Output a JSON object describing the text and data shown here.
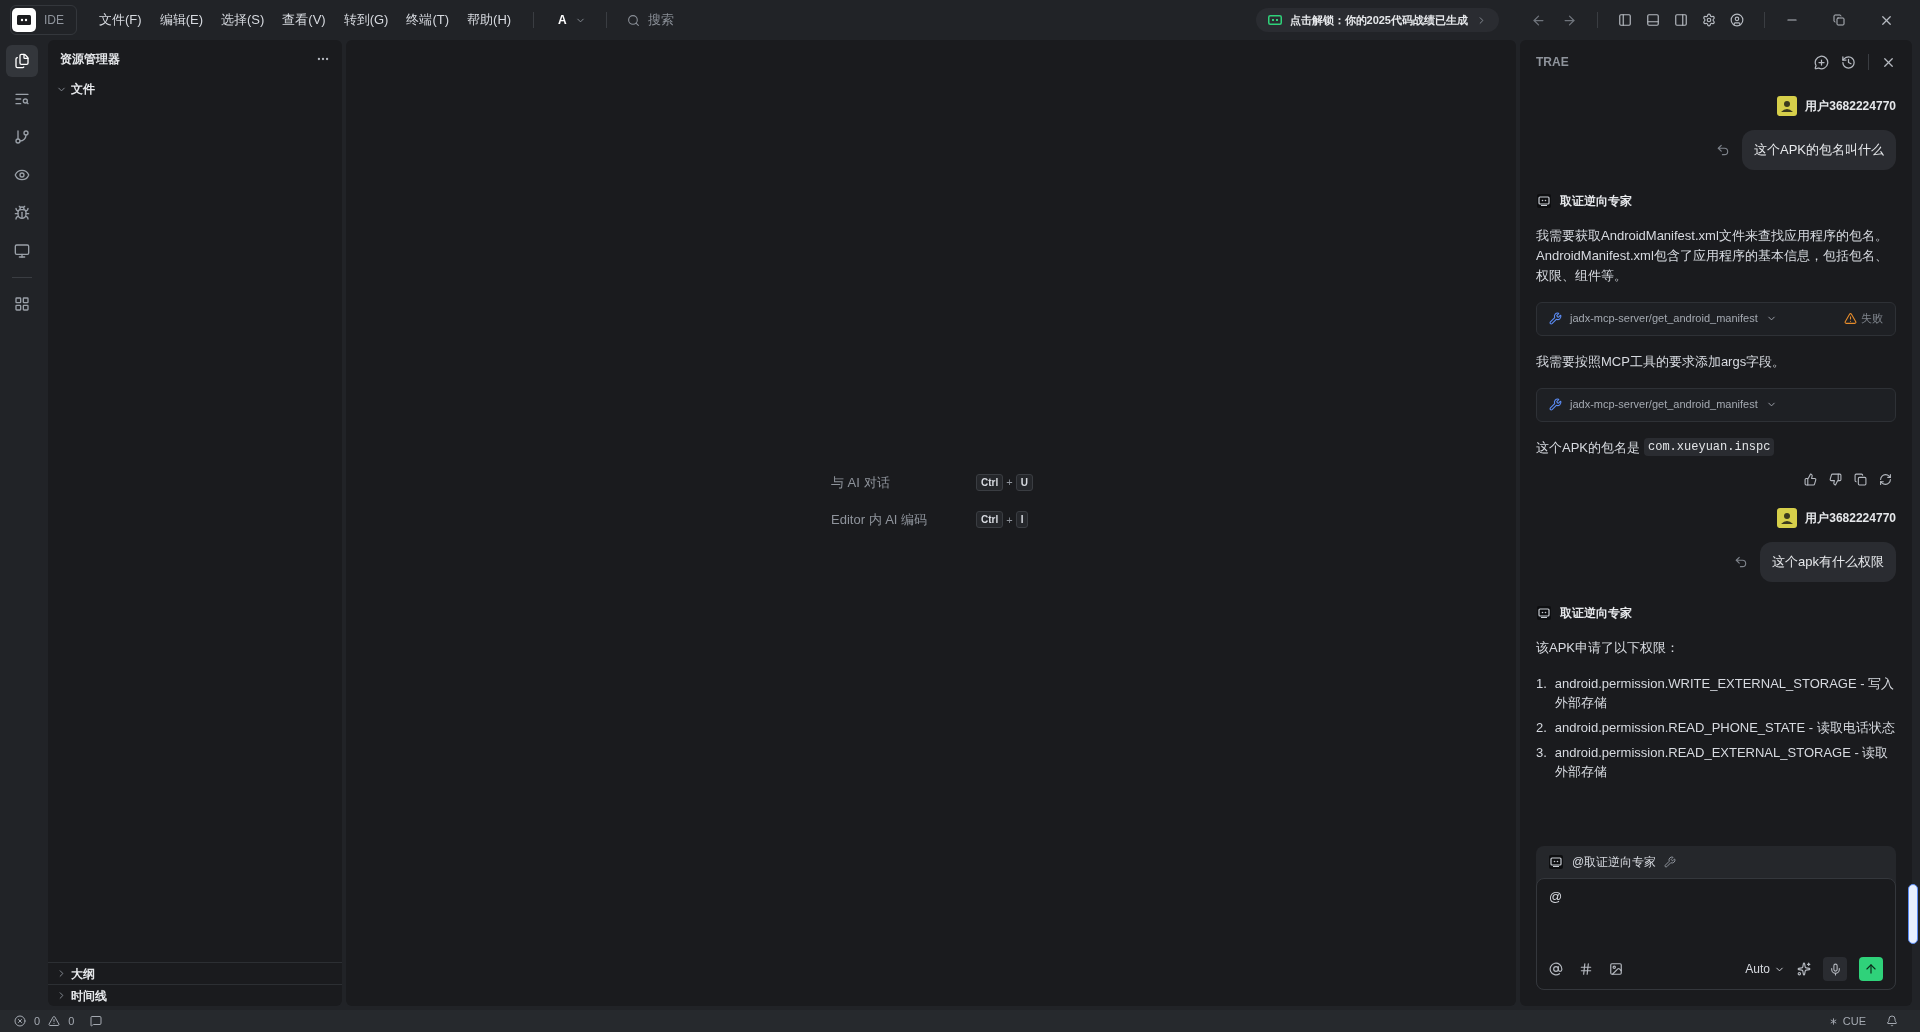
{
  "title_bar": {
    "app_label": "IDE",
    "menus": [
      "文件(F)",
      "编辑(E)",
      "选择(S)",
      "查看(V)",
      "转到(G)",
      "终端(T)",
      "帮助(H)"
    ],
    "font_button": "A",
    "search_placeholder": "搜索",
    "promo": "点击解锁：你的2025代码战绩已生成"
  },
  "activity_bar": [
    {
      "kind": "files",
      "selected": true
    },
    {
      "kind": "search",
      "selected": false
    },
    {
      "kind": "source_control",
      "selected": false
    },
    {
      "kind": "preview",
      "selected": false
    },
    {
      "kind": "debug",
      "selected": false
    },
    {
      "kind": "remote",
      "selected": false
    },
    {
      "kind": "extensions",
      "selected": false
    }
  ],
  "explorer": {
    "title": "资源管理器",
    "sections": [
      {
        "label": "文件",
        "expanded": true
      },
      {
        "label": "大纲",
        "expanded": false
      },
      {
        "label": "时间线",
        "expanded": false
      }
    ]
  },
  "editor": {
    "shortcuts": [
      {
        "label": "与 AI 对话",
        "keys": [
          "Ctrl",
          "+",
          "U"
        ]
      },
      {
        "label": "Editor 内 AI 编码",
        "keys": [
          "Ctrl",
          "+",
          "I"
        ]
      }
    ]
  },
  "chat": {
    "title": "TRAE",
    "messages": [
      {
        "kind": "user",
        "user": "用户3682224770",
        "text": "这个APK的包名叫什么"
      },
      {
        "kind": "agent",
        "agent": "取证逆向专家",
        "blocks": [
          {
            "kind": "text",
            "text": "我需要获取AndroidManifest.xml文件来查找应用程序的包名。AndroidManifest.xml包含了应用程序的基本信息，包括包名、权限、组件等。"
          },
          {
            "kind": "tool",
            "name": "jadx-mcp-server/get_android_manifest",
            "status": "失败"
          },
          {
            "kind": "text",
            "text": "我需要按照MCP工具的要求添加args字段。"
          },
          {
            "kind": "tool",
            "name": "jadx-mcp-server/get_android_manifest"
          },
          {
            "kind": "code_text",
            "text": "这个APK的包名是",
            "code": "com.xueyuan.inspc"
          }
        ],
        "feedback": true
      },
      {
        "kind": "user",
        "user": "用户3682224770",
        "text": "这个apk有什么权限"
      },
      {
        "kind": "agent",
        "agent": "取证逆向专家",
        "blocks": [
          {
            "kind": "text",
            "text": "该APK申请了以下权限："
          },
          {
            "kind": "list",
            "items": [
              {
                "number": "1.",
                "text": "android.permission.WRITE_EXTERNAL_STORAGE - 写入外部存储"
              },
              {
                "number": "2.",
                "text": "android.permission.READ_PHONE_STATE - 读取电话状态"
              },
              {
                "number": "3.",
                "text": "android.permission.READ_EXTERNAL_STORAGE - 读取外部存储"
              }
            ]
          }
        ],
        "feedback": false
      }
    ],
    "composer": {
      "mention": "@取证逆向专家",
      "value": "@",
      "model": "Auto"
    }
  },
  "status_bar": {
    "errors": "0",
    "warnings": "0",
    "right": "CUE"
  }
}
